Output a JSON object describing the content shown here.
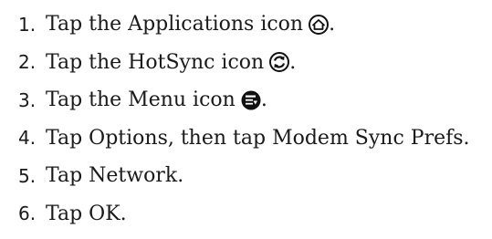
{
  "steps": [
    {
      "number": "1.",
      "text": "Tap the Applications icon",
      "icon": "applications-icon",
      "suffix": "."
    },
    {
      "number": "2.",
      "text": "Tap the HotSync icon",
      "icon": "hotsync-icon",
      "suffix": "."
    },
    {
      "number": "3.",
      "text": "Tap the Menu icon",
      "icon": "menu-icon",
      "suffix": "."
    },
    {
      "number": "4.",
      "text": "Tap Options, then tap Modem Sync Prefs.",
      "icon": null,
      "suffix": ""
    },
    {
      "number": "5.",
      "text": "Tap Network.",
      "icon": null,
      "suffix": ""
    },
    {
      "number": "6.",
      "text": "Tap OK.",
      "icon": null,
      "suffix": ""
    }
  ]
}
